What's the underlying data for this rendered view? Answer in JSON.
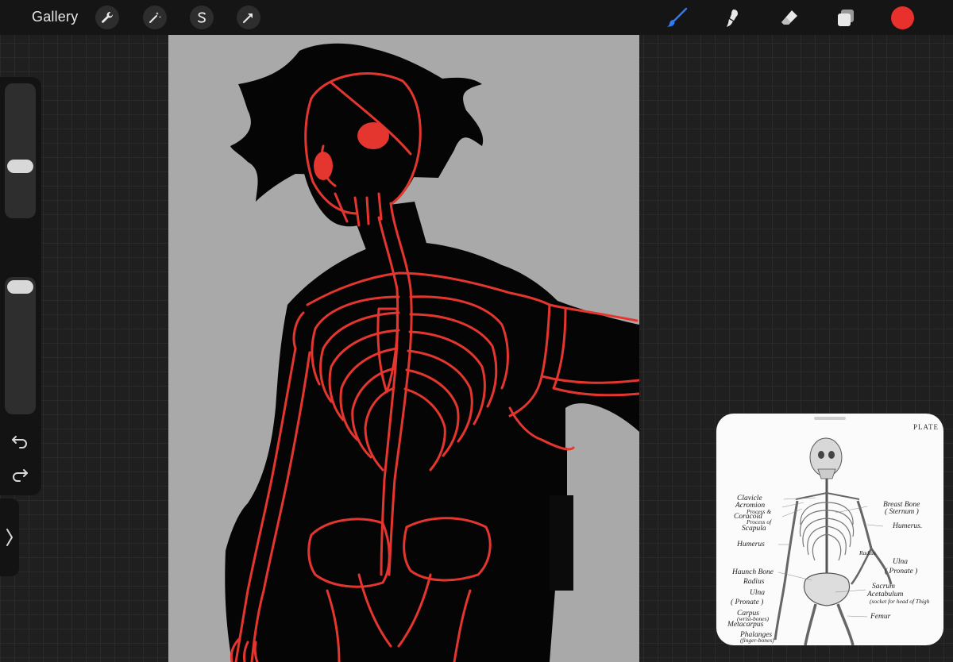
{
  "topbar": {
    "gallery_label": "Gallery",
    "tools": [
      "wrench-icon",
      "magic-wand-icon",
      "selection-icon",
      "transform-arrow-icon"
    ],
    "right_tools": [
      "brush-icon",
      "smudge-icon",
      "eraser-icon",
      "layers-icon"
    ],
    "brush_color": "#2f7bf5",
    "current_color": "#e8302c"
  },
  "sidebar": {
    "size_slider_level": 0.45,
    "opacity_slider_level": 0.95
  },
  "canvas": {
    "background": "#a9a9a9",
    "line_color": "#e4362f"
  },
  "reference": {
    "plate_label": "PLATE",
    "labels_left": {
      "clavicle": "Clavicle",
      "acromion": "Acromion",
      "process1": "Process &",
      "coracoid": "Coracoid",
      "process2": "Process of",
      "scapula": "Scapula",
      "humerus": "Humerus",
      "haunch": "Haunch Bone",
      "radius": "Radius",
      "ulna": "Ulna",
      "pronate": "( Pronate )",
      "carpus": "Carpus",
      "wrist": "(wrist-bones)",
      "metacarpus": "Metacarpus",
      "phalanges": "Phalanges",
      "finger": "(finger-bones)"
    },
    "labels_right": {
      "breastbone": "Breast Bone",
      "sternum": "( Sternum )",
      "humerus": "Humerus.",
      "radius": "Radius",
      "ulna": "Ulna",
      "pronate": "( Pronate )",
      "sacrum": "Sacrum",
      "acetabulum": "Acetabulum",
      "socket": "(socket for head of Thigh",
      "femur": "Femur"
    }
  }
}
